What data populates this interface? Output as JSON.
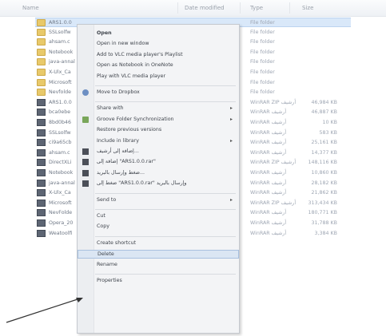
{
  "columns": {
    "name": "Name",
    "date": "Date modified",
    "type": "Type",
    "size": "Size"
  },
  "rows": [
    {
      "name": "ARS1.0.0",
      "type": "File folder",
      "size": "",
      "icon": "folder-icon",
      "selected": true
    },
    {
      "name": "SSLsolfw",
      "type": "File folder",
      "size": "",
      "icon": "folder-icon"
    },
    {
      "name": "ahsam.c",
      "type": "File folder",
      "size": "",
      "icon": "folder-icon"
    },
    {
      "name": "Notebook",
      "type": "File folder",
      "size": "",
      "icon": "folder-icon"
    },
    {
      "name": "java-annal",
      "type": "File folder",
      "size": "",
      "icon": "folder-icon"
    },
    {
      "name": "X-Ulx_Ca",
      "type": "File folder",
      "size": "",
      "icon": "folder-icon"
    },
    {
      "name": "Microsoft",
      "type": "File folder",
      "size": "",
      "icon": "folder-icon"
    },
    {
      "name": "Nevfolde",
      "type": "File folder",
      "size": "",
      "icon": "folder-icon"
    },
    {
      "name": "ARS1.0.0",
      "type": "WinRAR ZIP أرشيف",
      "size": "46,984 KB",
      "icon": "archive-icon"
    },
    {
      "name": "bca0ebe",
      "type": "WinRAR أرشيف",
      "size": "46,887 KB",
      "icon": "archive-icon"
    },
    {
      "name": "8bd0b46",
      "type": "WinRAR أرشيف",
      "size": "10 KB",
      "icon": "archive-icon"
    },
    {
      "name": "SSLsolfw",
      "type": "WinRAR أرشيف",
      "size": "583 KB",
      "icon": "archive-icon"
    },
    {
      "name": "ci9a65cb",
      "type": "WinRAR أرشيف",
      "size": "25,161 KB",
      "icon": "archive-icon"
    },
    {
      "name": "ahsam.c",
      "type": "WinRAR أرشيف",
      "size": "14,377 KB",
      "icon": "archive-icon"
    },
    {
      "name": "DirectXLi",
      "type": "WinRAR ZIP أرشيف",
      "size": "148,116 KB",
      "icon": "archive-icon"
    },
    {
      "name": "Notebook",
      "type": "WinRAR أرشيف",
      "size": "10,860 KB",
      "icon": "archive-icon"
    },
    {
      "name": "java-annal",
      "type": "WinRAR أرشيف",
      "size": "28,182 KB",
      "icon": "archive-icon"
    },
    {
      "name": "X-Ulx_Ca",
      "type": "WinRAR أرشيف",
      "size": "21,862 KB",
      "icon": "archive-icon"
    },
    {
      "name": "Microsoft",
      "type": "WinRAR ZIP أرشيف",
      "size": "313,434 KB",
      "icon": "archive-icon"
    },
    {
      "name": "NevFolde",
      "type": "WinRAR أرشيف",
      "size": "180,771 KB",
      "icon": "archive-icon"
    },
    {
      "name": "Opera_20",
      "type": "WinRAR أرشيف",
      "size": "31,788 KB",
      "icon": "archive-icon"
    },
    {
      "name": "Weatoolfi",
      "type": "WinRAR أرشيف",
      "size": "3,384 KB",
      "icon": "archive-icon"
    }
  ],
  "menu": [
    {
      "label": "Open",
      "bold": true,
      "icon": ""
    },
    {
      "label": "Open in new window",
      "icon": ""
    },
    {
      "label": "Add to VLC media player's Playlist",
      "icon": ""
    },
    {
      "label": "Open as Notebook in OneNote",
      "icon": ""
    },
    {
      "label": "Play with VLC media player",
      "icon": ""
    },
    {
      "sep": true
    },
    {
      "label": "Move to Dropbox",
      "icon": "dropbox-icon"
    },
    {
      "sep": true
    },
    {
      "label": "Share with",
      "arrow": true,
      "icon": ""
    },
    {
      "label": "Groove Folder Synchronization",
      "arrow": true,
      "icon": "groove-icon"
    },
    {
      "label": "Restore previous versions",
      "icon": ""
    },
    {
      "label": "Include in library",
      "arrow": true,
      "icon": ""
    },
    {
      "label": "إضافة إلى أرشيف...",
      "icon": "winrar-icon"
    },
    {
      "label": "إضافة إلى \"ARS1.0.0.rar\"",
      "icon": "winrar-icon"
    },
    {
      "label": "ضغط وإرسال بالبريد...",
      "icon": "winrar-icon"
    },
    {
      "label": "ضغط إلى \"ARS1.0.0.rar\" وإرسال بالبريد",
      "icon": "winrar-icon"
    },
    {
      "sep": true
    },
    {
      "label": "Send to",
      "arrow": true,
      "icon": ""
    },
    {
      "sep": true
    },
    {
      "label": "Cut",
      "icon": ""
    },
    {
      "label": "Copy",
      "icon": ""
    },
    {
      "sep": true
    },
    {
      "label": "Create shortcut",
      "icon": ""
    },
    {
      "label": "Delete",
      "highlight": true,
      "icon": ""
    },
    {
      "label": "Rename",
      "icon": ""
    },
    {
      "sep": true
    },
    {
      "label": "Properties",
      "icon": ""
    }
  ]
}
